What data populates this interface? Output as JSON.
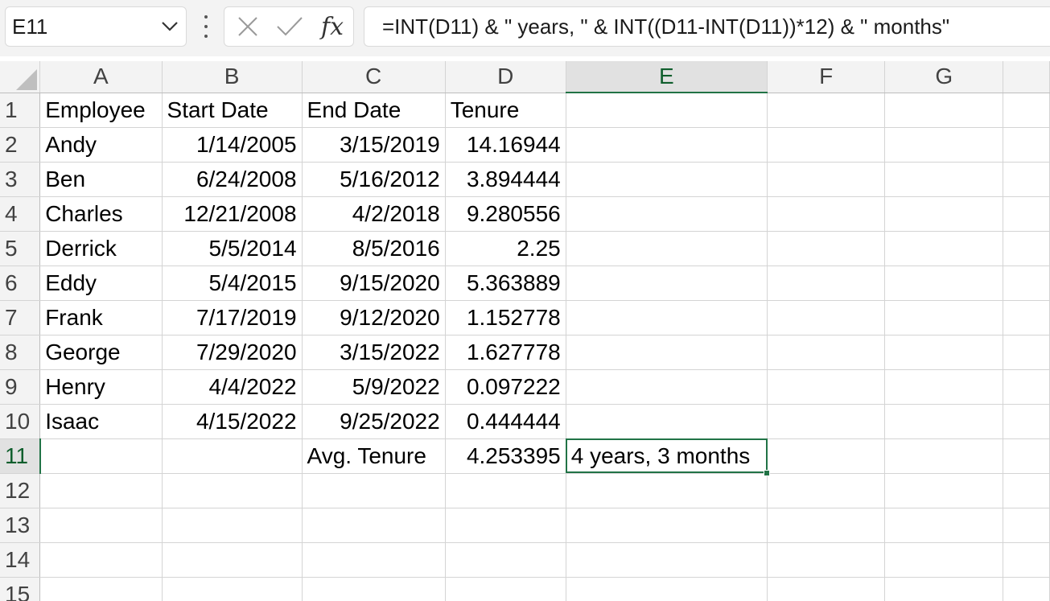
{
  "formula_bar": {
    "name_box": "E11",
    "cancel_icon": "close-x-icon",
    "enter_icon": "checkmark-icon",
    "fx_label": "fx",
    "formula": "=INT(D11) & \" years, \" & INT((D11-INT(D11))*12) & \" months\""
  },
  "sheet": {
    "columns": [
      "A",
      "B",
      "C",
      "D",
      "E",
      "F",
      "G"
    ],
    "selected_column": "E",
    "selected_row": "11",
    "selected_cell": "E11",
    "header_row": {
      "row": "1",
      "cells": [
        "Employee",
        "Start Date",
        "End Date",
        "Tenure"
      ]
    },
    "rows": [
      {
        "row": "2",
        "employee": "Andy",
        "start": "1/14/2005",
        "end": "3/15/2019",
        "tenure": "14.16944"
      },
      {
        "row": "3",
        "employee": "Ben",
        "start": "6/24/2008",
        "end": "5/16/2012",
        "tenure": "3.894444"
      },
      {
        "row": "4",
        "employee": "Charles",
        "start": "12/21/2008",
        "end": "4/2/2018",
        "tenure": "9.280556"
      },
      {
        "row": "5",
        "employee": "Derrick",
        "start": "5/5/2014",
        "end": "8/5/2016",
        "tenure": "2.25"
      },
      {
        "row": "6",
        "employee": "Eddy",
        "start": "5/4/2015",
        "end": "9/15/2020",
        "tenure": "5.363889"
      },
      {
        "row": "7",
        "employee": "Frank",
        "start": "7/17/2019",
        "end": "9/12/2020",
        "tenure": "1.152778"
      },
      {
        "row": "8",
        "employee": "George",
        "start": "7/29/2020",
        "end": "3/15/2022",
        "tenure": "1.627778"
      },
      {
        "row": "9",
        "employee": "Henry",
        "start": "4/4/2022",
        "end": "5/9/2022",
        "tenure": "0.097222"
      },
      {
        "row": "10",
        "employee": "Isaac",
        "start": "4/15/2022",
        "end": "9/25/2022",
        "tenure": "0.444444"
      }
    ],
    "summary_row": {
      "row": "11",
      "label": "Avg. Tenure",
      "value": "4.253395",
      "result": "4 years, 3 months"
    },
    "empty_rows": [
      "12",
      "13",
      "14",
      "15"
    ]
  },
  "colors": {
    "accent": "#217346",
    "header_bg": "#f3f3f3",
    "gridline": "#d4d4d4"
  }
}
